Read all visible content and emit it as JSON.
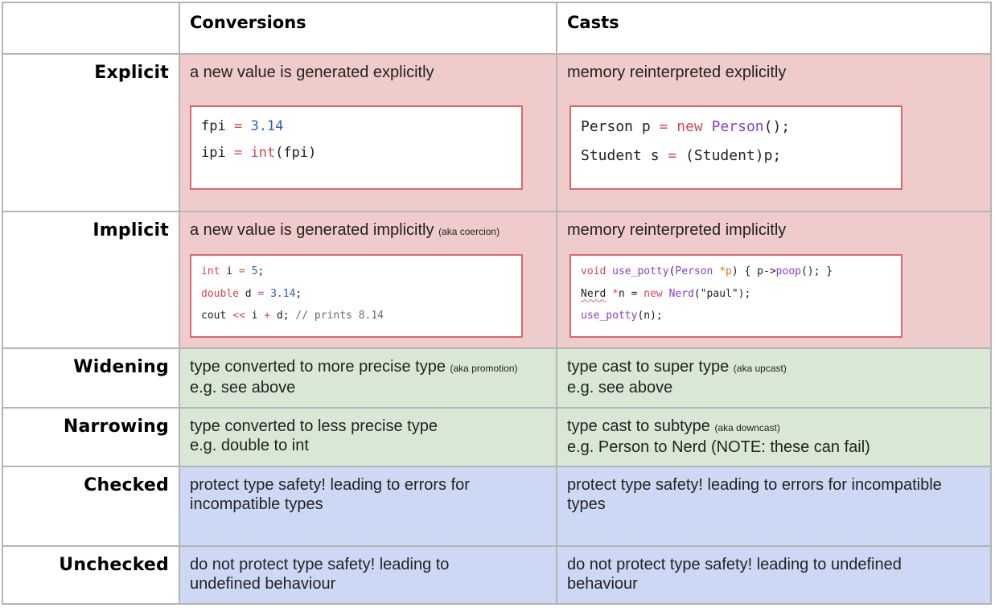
{
  "header": {
    "corner": "",
    "columns": [
      "Conversions",
      "Casts"
    ]
  },
  "rows": [
    {
      "label": "Explicit",
      "color": "#f0cbcb",
      "conversions": {
        "text": "a new value is generated explicitly",
        "aka": "",
        "code": [
          [
            {
              "t": "fpi ",
              "c": ""
            },
            {
              "t": "=",
              "c": "kw"
            },
            {
              "t": " ",
              "c": ""
            },
            {
              "t": "3.14",
              "c": "num"
            }
          ],
          [
            {
              "t": "ipi ",
              "c": ""
            },
            {
              "t": "=",
              "c": "kw"
            },
            {
              "t": " ",
              "c": ""
            },
            {
              "t": "int",
              "c": "kw"
            },
            {
              "t": "(fpi)",
              "c": ""
            }
          ]
        ]
      },
      "casts": {
        "text": "memory reinterpreted explicitly",
        "aka": "",
        "code": [
          [
            {
              "t": "Person p ",
              "c": ""
            },
            {
              "t": "=",
              "c": "kw"
            },
            {
              "t": " ",
              "c": ""
            },
            {
              "t": "new",
              "c": "kw"
            },
            {
              "t": " ",
              "c": ""
            },
            {
              "t": "Person",
              "c": "fn"
            },
            {
              "t": "();",
              "c": ""
            }
          ],
          [
            {
              "t": "Student s ",
              "c": ""
            },
            {
              "t": "=",
              "c": "kw"
            },
            {
              "t": " (Student)p;",
              "c": ""
            }
          ]
        ]
      }
    },
    {
      "label": "Implicit",
      "color": "#f0cbcb",
      "conversions": {
        "text": "a new value is generated implicitly",
        "aka": "(aka coercion)",
        "code": [
          [
            {
              "t": "int",
              "c": "kw"
            },
            {
              "t": " i ",
              "c": ""
            },
            {
              "t": "=",
              "c": "kw"
            },
            {
              "t": " ",
              "c": ""
            },
            {
              "t": "5",
              "c": "num"
            },
            {
              "t": ";",
              "c": ""
            }
          ],
          [
            {
              "t": "double",
              "c": "kw"
            },
            {
              "t": " d ",
              "c": ""
            },
            {
              "t": "=",
              "c": "kw"
            },
            {
              "t": " ",
              "c": ""
            },
            {
              "t": "3.14",
              "c": "num"
            },
            {
              "t": ";",
              "c": ""
            }
          ],
          [
            {
              "t": "cout ",
              "c": ""
            },
            {
              "t": "<<",
              "c": "kw"
            },
            {
              "t": " i ",
              "c": ""
            },
            {
              "t": "+",
              "c": "kw"
            },
            {
              "t": " d; ",
              "c": ""
            },
            {
              "t": "// prints 8.14",
              "c": "cm"
            }
          ]
        ]
      },
      "casts": {
        "text": "memory reinterpreted implicitly",
        "aka": "",
        "code": [
          [
            {
              "t": "void",
              "c": "kw"
            },
            {
              "t": " ",
              "c": ""
            },
            {
              "t": "use_potty",
              "c": "fn"
            },
            {
              "t": "(",
              "c": ""
            },
            {
              "t": "Person",
              "c": "fn"
            },
            {
              "t": " ",
              "c": ""
            },
            {
              "t": "*p",
              "c": "param"
            },
            {
              "t": ") { p->",
              "c": ""
            },
            {
              "t": "poop",
              "c": "fn"
            },
            {
              "t": "(); }",
              "c": ""
            }
          ],
          [
            {
              "t": "Nerd",
              "c": "squiggle"
            },
            {
              "t": " ",
              "c": ""
            },
            {
              "t": "*",
              "c": "kw"
            },
            {
              "t": "n = ",
              "c": ""
            },
            {
              "t": "new",
              "c": "kw"
            },
            {
              "t": " ",
              "c": ""
            },
            {
              "t": "Nerd",
              "c": "fn"
            },
            {
              "t": "(\"paul\");",
              "c": ""
            }
          ],
          [
            {
              "t": "use_potty",
              "c": "fn"
            },
            {
              "t": "(n);",
              "c": ""
            }
          ]
        ]
      }
    },
    {
      "label": "Widening",
      "color": "#d9e8d4",
      "conversions": {
        "text": "type converted to more precise type",
        "aka": "(aka promotion)",
        "line2": "e.g. see above"
      },
      "casts": {
        "text": "type cast to super type",
        "aka": "(aka upcast)",
        "line2": "e.g. see above"
      }
    },
    {
      "label": "Narrowing",
      "color": "#d9e8d4",
      "conversions": {
        "text": "type converted to less precise type",
        "aka": "",
        "line2": "e.g. double to int"
      },
      "casts": {
        "text": "type cast to subtype",
        "aka": "(aka downcast)",
        "line2": "e.g. Person to Nerd (NOTE: these can fail)"
      }
    },
    {
      "label": "Checked",
      "color": "#cdd9f4",
      "conversions": {
        "text": "protect type safety! leading to errors for incompatible types",
        "aka": ""
      },
      "casts": {
        "text": "protect type safety! leading to errors for incompatible types",
        "aka": ""
      }
    },
    {
      "label": "Unchecked",
      "color": "#cdd9f4",
      "conversions": {
        "text": "do not protect type safety! leading to undefined behaviour",
        "aka": ""
      },
      "casts": {
        "text": "do not protect type safety! leading to undefined behaviour",
        "aka": ""
      }
    }
  ]
}
